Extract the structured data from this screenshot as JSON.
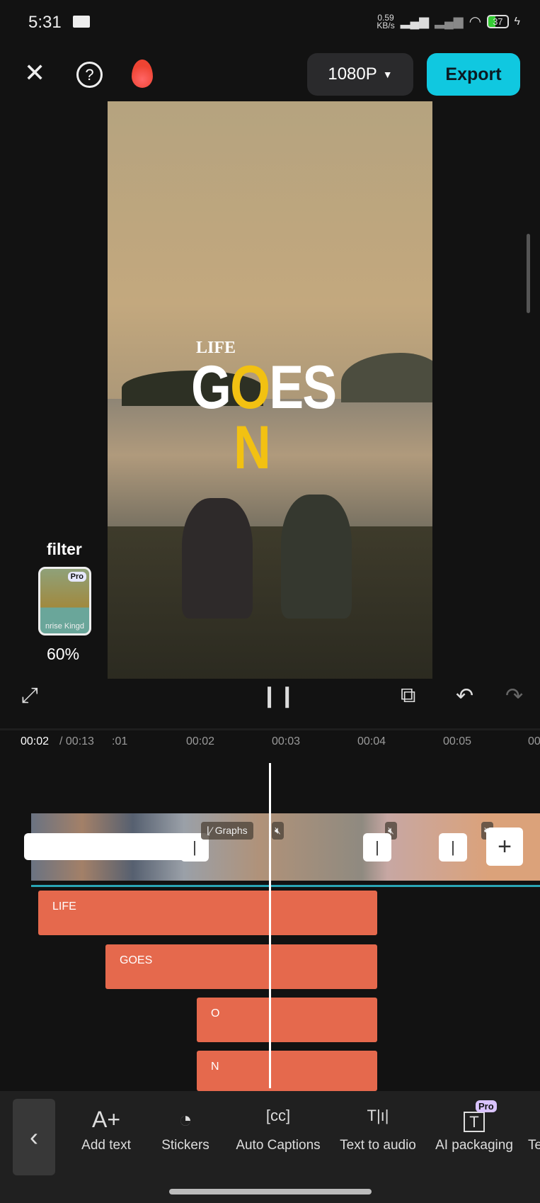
{
  "status_bar": {
    "time": "5:31",
    "net_speed": "0.59",
    "net_unit": "KB/s",
    "battery": "37"
  },
  "top_bar": {
    "resolution": "1080P",
    "export_label": "Export"
  },
  "preview": {
    "overlay_text": {
      "line1": "LIFE",
      "line2_a": "G",
      "line2_b": "O",
      "line2_c": "ES",
      "line3": "N"
    }
  },
  "filter": {
    "label": "filter",
    "thumb_name": "nrise Kingd",
    "badge": "Pro",
    "intensity": "60%"
  },
  "timeline": {
    "current": "00:02",
    "total": "/ 00:13",
    "ticks": [
      ":01",
      "00:02",
      "00:03",
      "00:04",
      "00:05",
      "00"
    ],
    "clip_tag": "Graphs",
    "text_clips": [
      "LIFE",
      "GOES",
      "O",
      "N"
    ]
  },
  "toolbar": {
    "items": [
      {
        "label": "Add text",
        "icon": "A+"
      },
      {
        "label": "Stickers",
        "icon": "◔"
      },
      {
        "label": "Auto Captions",
        "icon": "[cc]"
      },
      {
        "label": "Text to audio",
        "icon": "T|ı|"
      },
      {
        "label": "AI packaging",
        "icon": "T",
        "badge": "Pro"
      },
      {
        "label": "Te"
      }
    ]
  }
}
